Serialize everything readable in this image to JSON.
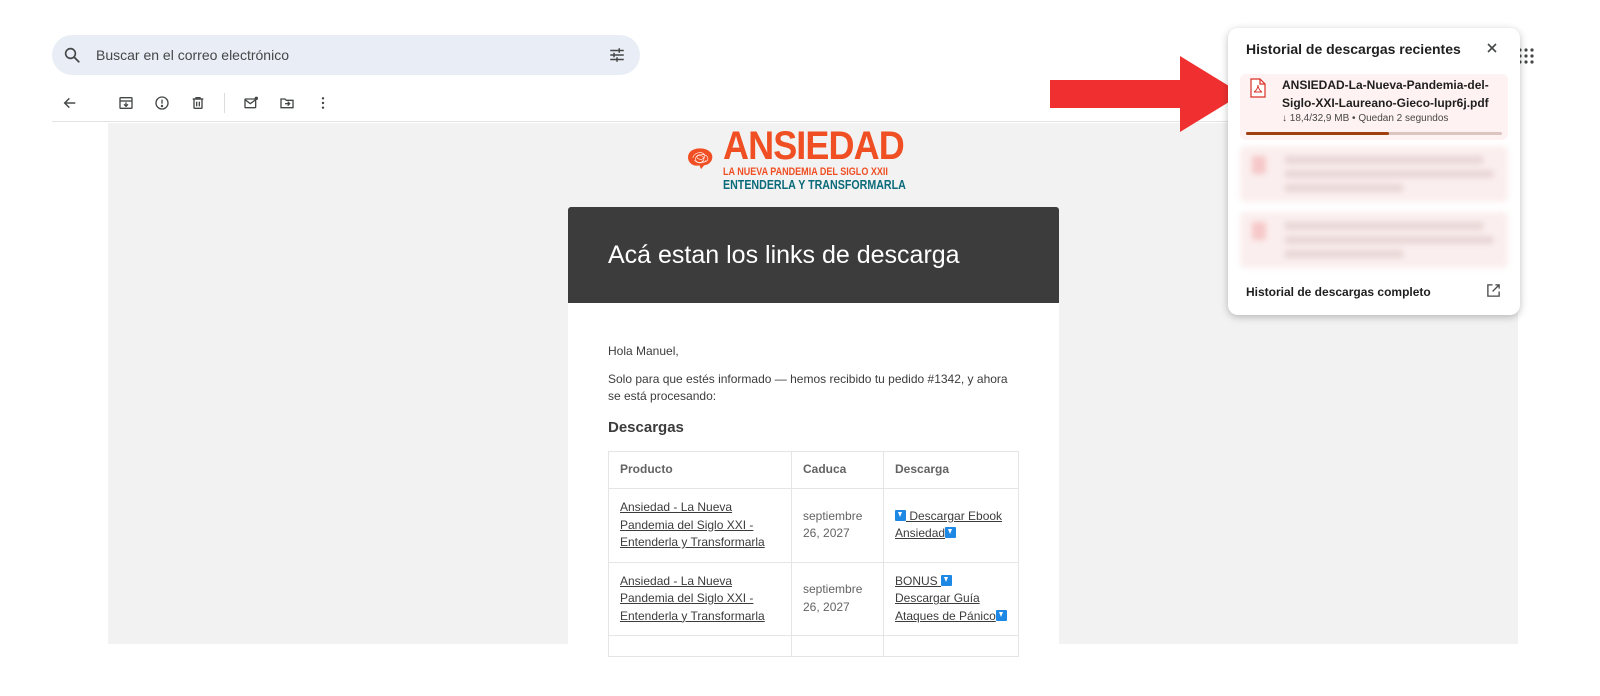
{
  "search": {
    "placeholder": "Buscar en el correo electrónico",
    "icons": {
      "search": "search-icon",
      "filter": "filter-sliders-icon"
    }
  },
  "toolbar": {
    "icons": [
      "back-arrow-icon",
      "archive-icon",
      "report-spam-icon",
      "delete-icon",
      "mark-unread-icon",
      "move-to-icon",
      "more-vert-icon"
    ]
  },
  "logo": {
    "title": "ANSIEDAD",
    "line1": "LA NUEVA PANDEMIA DEL SIGLO XXII",
    "line2": "ENTENDERLA Y TRANSFORMARLA",
    "colors": {
      "orange": "#f04e23",
      "teal": "#0b6b7a"
    }
  },
  "email": {
    "header_title": "Acá estan los links de descarga",
    "greeting": "Hola Manuel,",
    "intro": "Solo para que estés informado — hemos recibido tu pedido #1342, y ahora se está procesando:",
    "section_title": "Descargas",
    "table": {
      "headers": [
        "Producto",
        "Caduca",
        "Descarga"
      ],
      "rows": [
        {
          "product": "Ansiedad - La Nueva Pandemia del Siglo XXI - Entenderla y Transformarla",
          "expires": "septiembre 26, 2027",
          "download_prefix": "",
          "download_label": " Descargar Ebook Ansiedad"
        },
        {
          "product": "Ansiedad - La Nueva Pandemia del Siglo XXI - Entenderla y Transformarla",
          "expires": "septiembre 26, 2027",
          "download_prefix": "BONUS ",
          "download_label": " Descargar Guía Ataques de Pánico"
        }
      ]
    }
  },
  "downloads_panel": {
    "title": "Historial de descargas recientes",
    "active_item": {
      "file_name": "ANSIEDAD-La-Nueva-Pandemia-del-Siglo-XXI-Laureano-Gieco-lupr6j.pdf",
      "status": "↓ 18,4/32,9 MB • Quedan 2 segundos",
      "progress": 0.56
    },
    "footer_link": "Historial de descargas completo",
    "accent_color": "#a0400f"
  },
  "annotation": {
    "arrow_color": "#f03030"
  }
}
